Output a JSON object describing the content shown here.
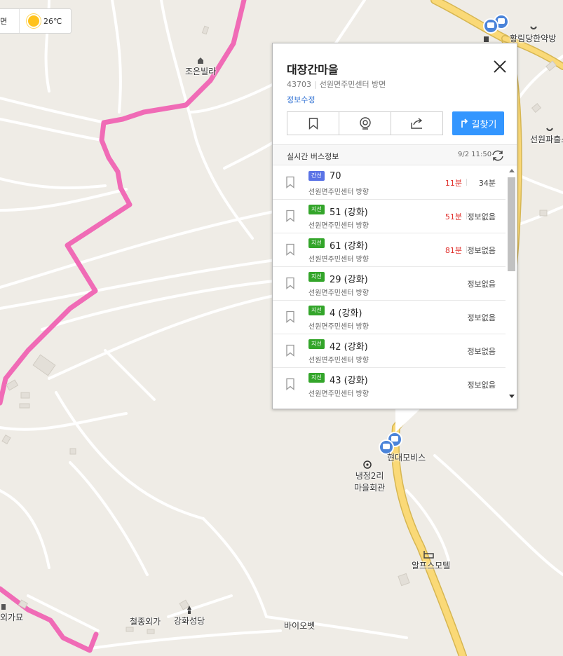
{
  "weather": {
    "left_label": "면",
    "temperature": "26℃",
    "icon": "sun-icon"
  },
  "map_labels": {
    "jo_eun_villa": "조은빌라",
    "hwangrimdang": "황림당한약방",
    "seonwon_police": "선원파출소",
    "hyundai_mobis": "현대모비스",
    "naengjeong": "냉정2리",
    "naengjeong2": "마을회관",
    "alps_motel": "알프스모텔",
    "cheoljong": "철종외가",
    "ganghwa_church": "강화성당",
    "bio_pet": "바이오벳",
    "oe_gamyo": "외가묘"
  },
  "panel": {
    "title": "대장간마을",
    "stop_id": "43703",
    "direction": "선원면주민센터 방면",
    "edit_label": "정보수정",
    "route_button_label": "길찾기",
    "realtime_title": "실시간 버스정보",
    "realtime_time": "9/2 11:50",
    "buses": [
      {
        "type": "간선",
        "type_color": "#5a73e6",
        "number": "70",
        "dir": "선원면주민센터 방향",
        "arr1": "11분",
        "arr2": "34분"
      },
      {
        "type": "지선",
        "type_color": "#33a52a",
        "number": "51 (강화)",
        "dir": "선원면주민센터 방향",
        "arr1": "51분",
        "arr2": "정보없음"
      },
      {
        "type": "지선",
        "type_color": "#33a52a",
        "number": "61 (강화)",
        "dir": "선원면주민센터 방향",
        "arr1": "81분",
        "arr2": "정보없음"
      },
      {
        "type": "지선",
        "type_color": "#33a52a",
        "number": "29 (강화)",
        "dir": "선원면주민센터 방향",
        "arr1": "",
        "arr2": "정보없음"
      },
      {
        "type": "지선",
        "type_color": "#33a52a",
        "number": "4 (강화)",
        "dir": "선원면주민센터 방향",
        "arr1": "",
        "arr2": "정보없음"
      },
      {
        "type": "지선",
        "type_color": "#33a52a",
        "number": "42 (강화)",
        "dir": "선원면주민센터 방향",
        "arr1": "",
        "arr2": "정보없음"
      },
      {
        "type": "지선",
        "type_color": "#33a52a",
        "number": "43 (강화)",
        "dir": "선원면주민센터 방향",
        "arr1": "",
        "arr2": "정보없음"
      }
    ]
  },
  "colors": {
    "route": "#f06bb6",
    "highway": "#fad977",
    "accent": "#3396ff",
    "map_bg": "#efece6"
  }
}
